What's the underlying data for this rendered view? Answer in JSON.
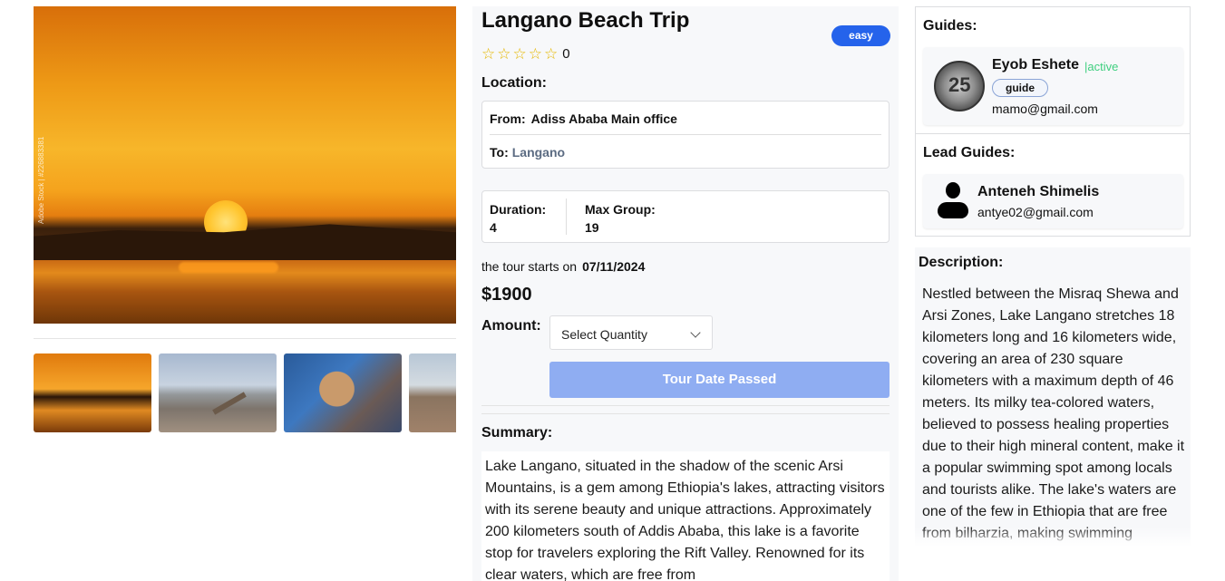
{
  "gallery": {
    "watermark": "Adobe Stock | #226883381",
    "thumbnail_count": 4
  },
  "tour": {
    "title": "Langano Beach Trip",
    "difficulty": "easy",
    "rating_stars": 5,
    "rating_value": "0",
    "location_label": "Location:",
    "from_label": "From:",
    "from_value": "Adiss Ababa Main office",
    "to_label": "To:",
    "to_value": "Langano",
    "duration_label": "Duration:",
    "duration_value": "4",
    "max_group_label": "Max Group:",
    "max_group_value": "19",
    "starts_text": "the tour starts on",
    "start_date": "07/11/2024",
    "price": "$1900",
    "amount_label": "Amount:",
    "quantity_placeholder": "Select Quantity",
    "status_button": "Tour Date Passed",
    "summary_label": "Summary:",
    "summary_text": "Lake Langano, situated in the shadow of the scenic Arsi Mountains, is a gem among Ethiopia's lakes, attracting visitors with its serene beauty and unique attractions. Approximately 200 kilometers south of Addis Ababa, this lake is a favorite stop for travelers exploring the Rift Valley. Renowned for its clear waters, which are free from"
  },
  "guides": {
    "label": "Guides:",
    "items": [
      {
        "name": "Eyob Eshete",
        "status": "|active",
        "role": "guide",
        "email": "mamo@gmail.com"
      }
    ]
  },
  "lead_guides": {
    "label": "Lead Guides:",
    "items": [
      {
        "name": "Anteneh Shimelis",
        "email": "antye02@gmail.com"
      }
    ]
  },
  "description": {
    "label": "Description:",
    "text": "Nestled between the Misraq Shewa and Arsi Zones, Lake Langano stretches 18 kilometers long and 16 kilometers wide, covering an area of 230 square kilometers with a maximum depth of 46 meters. Its milky tea-colored waters, believed to possess healing properties due to their high mineral content, make it a popular swimming spot among locals and tourists alike. The lake's waters are one of the few in Ethiopia that are free from bilharzia, making swimming"
  },
  "colors": {
    "accent": "#2563eb",
    "button_disabled": "#8fadf2",
    "active_status": "#3fcf7f",
    "star": "#e5b700"
  },
  "icons": [
    "star-outline-icon",
    "chevron-down-icon",
    "user-icon"
  ]
}
